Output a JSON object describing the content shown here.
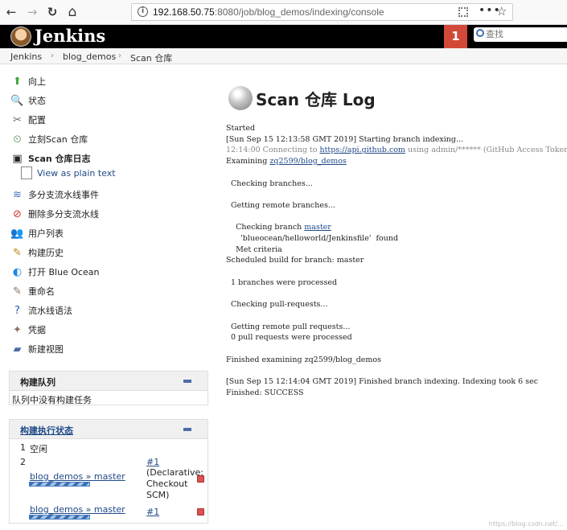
{
  "browser": {
    "back": "←",
    "forward": "→",
    "reload": "↻",
    "home": "⌂",
    "url_host": "192.168.50.75",
    "url_rest": ":8080/job/blog_demos/indexing/console",
    "more": "•••",
    "star": "☆"
  },
  "header": {
    "title": "Jenkins",
    "notification_count": "1",
    "search_placeholder": "查找"
  },
  "breadcrumb": {
    "items": [
      "Jenkins",
      "blog_demos",
      "Scan 仓库"
    ],
    "separator": "›"
  },
  "sidebar": {
    "items": [
      {
        "label": "向上",
        "icon": "up-arrow-icon",
        "glyph": "⬆",
        "color": "#3fa63f"
      },
      {
        "label": "状态",
        "icon": "magnifier-icon",
        "glyph": "🔍",
        "color": "#3b6fb6"
      },
      {
        "label": "配置",
        "icon": "wrench-icon",
        "glyph": "✂",
        "color": "#666"
      },
      {
        "label": "立刻Scan 仓库",
        "icon": "clock-play-icon",
        "glyph": "⏲",
        "color": "#2e7d32"
      },
      {
        "label": "Scan 仓库日志",
        "icon": "terminal-icon",
        "glyph": "▣",
        "color": "#222"
      },
      {
        "label": "多分支流水线事件",
        "icon": "pipeline-events-icon",
        "glyph": "≋",
        "color": "#3b6fb6"
      },
      {
        "label": "删除多分支流水线",
        "icon": "no-entry-icon",
        "glyph": "⊘",
        "color": "#d32f2f"
      },
      {
        "label": "用户列表",
        "icon": "users-icon",
        "glyph": "👥",
        "color": "#5a7"
      },
      {
        "label": "构建历史",
        "icon": "notepad-icon",
        "glyph": "✎",
        "color": "#b8860b"
      },
      {
        "label": "打开 Blue Ocean",
        "icon": "blue-ocean-icon",
        "glyph": "◐",
        "color": "#1e88e5"
      },
      {
        "label": "重命名",
        "icon": "rename-icon",
        "glyph": "✎",
        "color": "#8d6e63"
      },
      {
        "label": "流水线语法",
        "icon": "help-icon",
        "glyph": "?",
        "color": "#1e5aa8"
      },
      {
        "label": "凭据",
        "icon": "credentials-icon",
        "glyph": "✦",
        "color": "#8d6e63"
      },
      {
        "label": "新建视图",
        "icon": "folder-icon",
        "glyph": "▰",
        "color": "#4a6da7"
      }
    ],
    "subtask": "View as plain text"
  },
  "build_queue": {
    "title": "构建队列",
    "empty_text": "队列中没有构建任务"
  },
  "executors": {
    "title": "构建执行状态",
    "rows": [
      {
        "num": "1",
        "status": "空闲"
      },
      {
        "num": "2",
        "job": "blog_demos » master",
        "build": "#1",
        "detail": [
          "(Declarative:",
          "Checkout",
          "SCM)"
        ]
      },
      {
        "job": "blog_demos » master",
        "build": "#1"
      }
    ]
  },
  "main": {
    "title": "Scan 仓库 Log",
    "log": [
      {
        "text": "Started"
      },
      {
        "text": "[Sun Sep 15 12:13:58 GMT 2019] Starting branch indexing..."
      },
      {
        "text": "12:14:00 Connecting to ",
        "link": "https://api.github.com",
        "after": " using admin/****** (GitHub Access Token)",
        "dim": true
      },
      {
        "text": "Examining ",
        "link": "zq2599/blog_demos",
        "after": ""
      },
      {
        "text": ""
      },
      {
        "text": "  Checking branches..."
      },
      {
        "text": ""
      },
      {
        "text": "  Getting remote branches..."
      },
      {
        "text": ""
      },
      {
        "text": "    Checking branch ",
        "link": "master",
        "after": ""
      },
      {
        "text": "      'blueocean/helloworld/Jenkinsfile'  found"
      },
      {
        "text": "    Met criteria"
      },
      {
        "text": "Scheduled build for branch: master"
      },
      {
        "text": ""
      },
      {
        "text": "  1 branches were processed"
      },
      {
        "text": ""
      },
      {
        "text": "  Checking pull-requests..."
      },
      {
        "text": ""
      },
      {
        "text": "  Getting remote pull requests..."
      },
      {
        "text": "  0 pull requests were processed"
      },
      {
        "text": ""
      },
      {
        "text": "Finished examining zq2599/blog_demos"
      },
      {
        "text": ""
      },
      {
        "text": "[Sun Sep 15 12:14:04 GMT 2019] Finished branch indexing. Indexing took 6 sec"
      },
      {
        "text": "Finished: SUCCESS"
      }
    ]
  },
  "watermark": "https://blog.csdn.net/..."
}
